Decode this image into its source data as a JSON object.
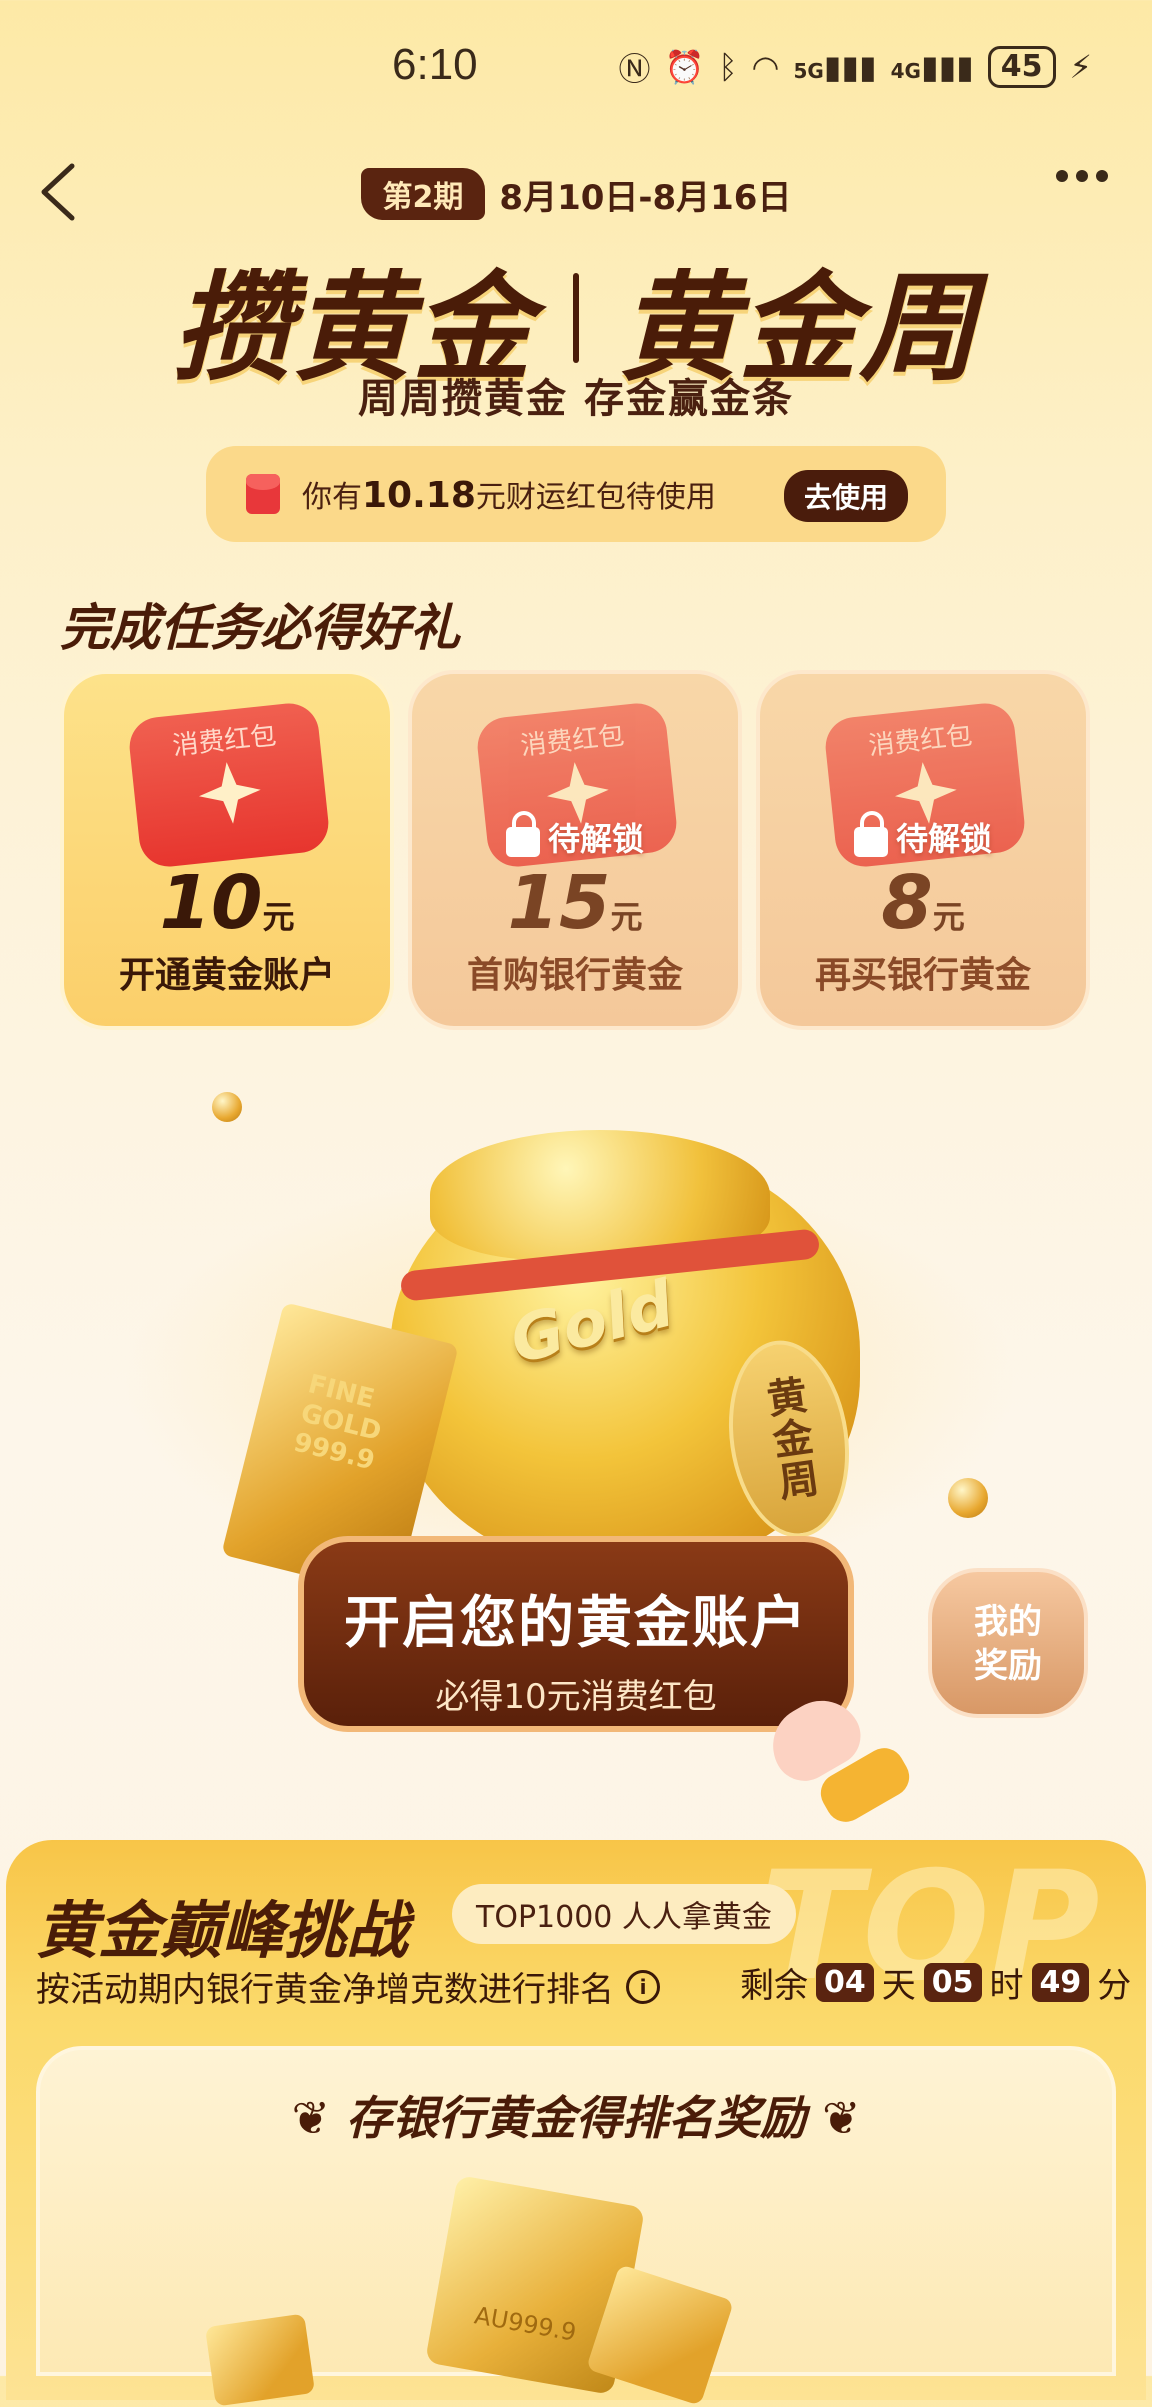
{
  "status_bar": {
    "time": "6:10",
    "network_5g": "5G",
    "network_4g": "4G",
    "battery": "45"
  },
  "header": {
    "period_badge": "第2期",
    "period_dates": "8月10日-8月16日",
    "title_left": "攒黄金",
    "title_right": "黄金周",
    "subtitle": "周周攒黄金 存金赢金条"
  },
  "notice": {
    "prefix": "你有",
    "amount": "10.18",
    "suffix": "元财运红包待使用",
    "button": "去使用"
  },
  "tasks": {
    "section_title": "完成任务必得好礼",
    "packet_label": "消费红包",
    "lock_label": "待解锁",
    "unit": "元",
    "items": [
      {
        "amount": "10",
        "label": "开通黄金账户",
        "locked": false
      },
      {
        "amount": "15",
        "label": "首购银行黄金",
        "locked": true
      },
      {
        "amount": "8",
        "label": "再买银行黄金",
        "locked": true
      }
    ]
  },
  "hero": {
    "gold_tag": "Gold",
    "seal_text": "黄金周",
    "bar_text": "FINE GOLD 999.9"
  },
  "cta": {
    "title": "开启您的黄金账户",
    "subtitle": "必得10元消费红包"
  },
  "rewards_button": {
    "line1": "我的",
    "line2": "奖励"
  },
  "challenge": {
    "watermark": "TOP",
    "title": "黄金巅峰挑战",
    "badge": "TOP1000 人人拿黄金",
    "description": "按活动期内银行黄金净增克数进行排名",
    "countdown_prefix": "剩余",
    "days": "04",
    "days_unit": "天",
    "hours": "05",
    "hours_unit": "时",
    "minutes": "49",
    "minutes_unit": "分",
    "inner_title": "存银行黄金得排名奖励",
    "bar_label": "AU999.9"
  },
  "colors": {
    "brand_brown": "#4a1c08",
    "gold": "#f3c43a",
    "red_packet": "#e7352e"
  }
}
